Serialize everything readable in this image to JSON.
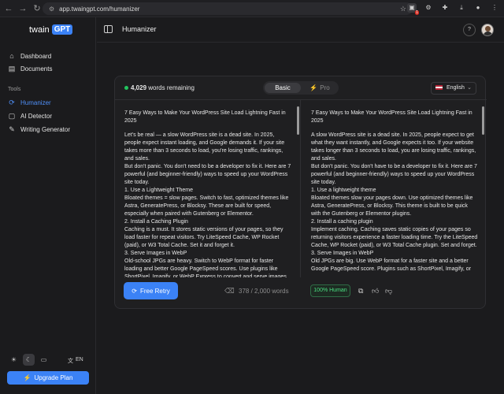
{
  "browser": {
    "url": "app.twaingpt.com/humanizer",
    "badge_count": "1"
  },
  "brand": {
    "name_left": "twain",
    "name_right": "GPT"
  },
  "sidebar": {
    "items_top": [
      {
        "label": "Dashboard",
        "icon": "home-icon"
      },
      {
        "label": "Documents",
        "icon": "document-icon"
      }
    ],
    "tools_label": "Tools",
    "items_tools": [
      {
        "label": "Humanizer",
        "icon": "refresh-icon",
        "active": true
      },
      {
        "label": "AI Detector",
        "icon": "robot-icon"
      },
      {
        "label": "Writing Generator",
        "icon": "pencil-icon"
      }
    ],
    "language": "EN",
    "upgrade_label": "Upgrade Plan"
  },
  "header": {
    "title": "Humanizer",
    "help": "?"
  },
  "card": {
    "words_count": "4,029",
    "words_suffix": "words remaining",
    "mode_basic": "Basic",
    "mode_pro": "Pro",
    "language": "English",
    "input_paragraphs": [
      "7 Easy Ways to Make Your WordPress Site Load Lightning Fast in 2025",
      "Let's be real — a slow WordPress site is a dead site. In 2025, people expect instant loading, and Google demands it. If your site takes more than 3 seconds to load, you're losing traffic, rankings, and sales.",
      "But don't panic. You don't need to be a developer to fix it. Here are 7 powerful (and beginner-friendly) ways to speed up your WordPress site today.",
      "1. Use a Lightweight Theme",
      "Bloated themes = slow pages. Switch to fast, optimized themes like Astra, GeneratePress, or Blocksy. These are built for speed, especially when paired with Gutenberg or Elementor.",
      "2. Install a Caching Plugin",
      "Caching is a must. It stores static versions of your pages, so they load faster for repeat visitors. Try LiteSpeed Cache, WP Rocket (paid), or W3 Total Cache. Set it and forget it.",
      "3. Serve Images in WebP",
      "Old-school JPGs are heavy. Switch to WebP format for faster loading and better Google PageSpeed scores. Use plugins like ShortPixel, Imagify, or WebP Express to convert and serve images"
    ],
    "output_paragraphs": [
      "7 Easy Ways to Make Your WordPress Site Load Lightning Fast in 2025",
      "A slow WordPress site is a dead site. In 2025, people expect to get what they want instantly, and Google expects it too. If your website takes longer than 3 seconds to load, you are losing traffic, rankings, and sales.",
      "But don't panic. You don't have to be a developer to fix it. Here are 7 powerful (and beginner-friendly) ways to speed up your WordPress site today.",
      "1. Use a lightweight theme",
      "Bloated themes slow your pages down. Use optimized themes like Astra, GeneratePress, or Blocksy. This theme is built to be quick with the Gutenberg or Elementor plugins.",
      "2. Install a caching plugin",
      "Implement caching. Caching saves static copies of your pages so returning visitors experience a faster loading time. Try the LiteSpeed Cache, WP Rocket (paid), or W3 Total Cache plugin. Set and forget.",
      "3. Serve Images in WebP",
      "Old JPGs are big. Use WebP format for a faster site and a better Google PageSpeed score. Plugins such as ShortPixel, Imagify, or"
    ],
    "retry_label": "Free Retry",
    "word_count": "378 / 2,000 words",
    "human_score": "100% Human"
  }
}
